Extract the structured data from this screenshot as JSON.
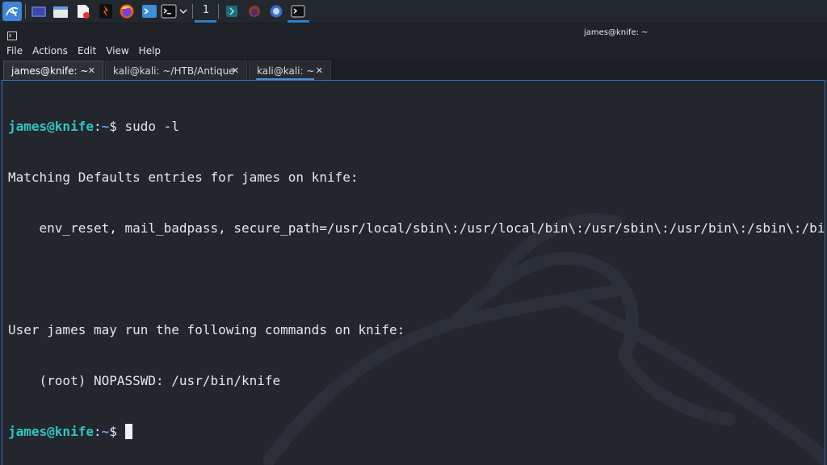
{
  "window": {
    "title": "james@knife: ~"
  },
  "taskbar": {
    "workspace_number": "1",
    "icons": [
      "kali-menu-icon",
      "desktop-icon",
      "file-manager-icon",
      "text-editor-icon",
      "burp-icon",
      "firefox-icon",
      "terminal-emulator-icon",
      "terminal-icon",
      "chevron-down-icon",
      "app-icon",
      "firefox-icon",
      "browser-icon",
      "terminal-icon"
    ]
  },
  "menu": [
    "File",
    "Actions",
    "Edit",
    "View",
    "Help"
  ],
  "tabs": [
    {
      "label": "james@knife: ~",
      "close": "✕",
      "active": true
    },
    {
      "label": "kali@kali: ~/HTB/Antique",
      "close": "✕",
      "active": false
    },
    {
      "label": "kali@kali: ~",
      "close": "✕",
      "active": false
    }
  ],
  "terminal": {
    "prompt_user": "james@knife",
    "prompt_colon": ":",
    "prompt_dir": "~",
    "prompt_dollar": "$ ",
    "command": "sudo -l",
    "output": [
      "Matching Defaults entries for james on knife:",
      "    env_reset, mail_badpass, secure_path=/usr/local/sbin\\:/usr/local/bin\\:/usr/sbin\\:/usr/bin\\:/sbin\\:/bi",
      "",
      "User james may run the following commands on knife:",
      "    (root) NOPASSWD: /usr/bin/knife"
    ],
    "colors": {
      "user": "#2ec6c2",
      "dir": "#5ea2f0",
      "text": "#e7e7e7",
      "background": "#23262d"
    }
  }
}
